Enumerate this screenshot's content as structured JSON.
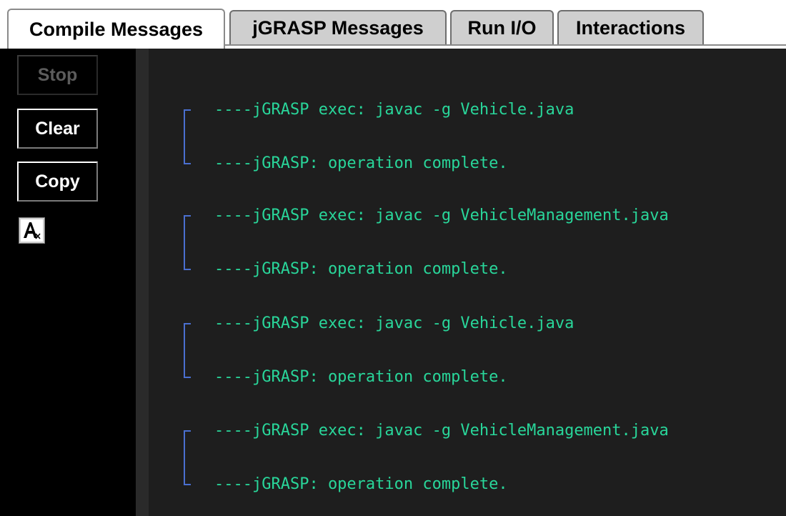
{
  "tabs": [
    {
      "label": "Compile Messages",
      "active": true
    },
    {
      "label": "jGRASP Messages",
      "active": false
    },
    {
      "label": "Run I/O",
      "active": false
    },
    {
      "label": "Interactions",
      "active": false
    }
  ],
  "buttons": {
    "stop_label": "Stop",
    "stop_enabled": false,
    "clear_label": "Clear",
    "copy_label": "Copy",
    "font_icon": "font-size-icon"
  },
  "messages": [
    {
      "exec": "----jGRASP exec: javac -g Vehicle.java",
      "done": "----jGRASP: operation complete."
    },
    {
      "exec": "----jGRASP exec: javac -g VehicleManagement.java",
      "done": "----jGRASP: operation complete."
    },
    {
      "exec": "----jGRASP exec: javac -g Vehicle.java",
      "done": "----jGRASP: operation complete."
    },
    {
      "exec": "----jGRASP exec: javac -g VehicleManagement.java",
      "done": "----jGRASP: operation complete."
    }
  ],
  "colors": {
    "message_text": "#29d69a",
    "bracket": "#4a6fd0",
    "message_bg": "#1e1e1e",
    "panel_bg": "#000000",
    "disabled_text": "#5c5c5c"
  }
}
